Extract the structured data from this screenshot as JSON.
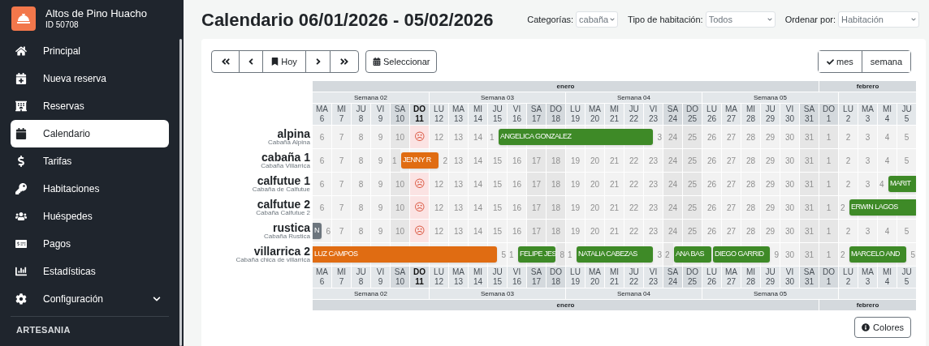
{
  "sidebar": {
    "brand": {
      "name": "Altos de Pino Huacho",
      "id": "ID 50708"
    },
    "items": [
      {
        "label": "Principal",
        "selected": false
      },
      {
        "label": "Nueva reserva",
        "selected": false
      },
      {
        "label": "Reservas",
        "selected": false
      },
      {
        "label": "Calendario",
        "selected": true
      },
      {
        "label": "Tarifas",
        "selected": false
      },
      {
        "label": "Habitaciones",
        "selected": false
      },
      {
        "label": "Huéspedes",
        "selected": false
      },
      {
        "label": "Pagos",
        "selected": false
      },
      {
        "label": "Estadísticas",
        "selected": false
      },
      {
        "label": "Configuración",
        "selected": false,
        "expanded": false
      }
    ],
    "section": "ARTESANIA"
  },
  "header": {
    "title": "Calendario 06/01/2026 - 05/02/2026",
    "filters": [
      {
        "label": "Categorías:",
        "value": "cabaña"
      },
      {
        "label": "Tipo de habitación:",
        "value": "Todos"
      },
      {
        "label": "Ordenar por:",
        "value": "Habitación"
      }
    ]
  },
  "toolbar": {
    "today_button": "Hoy",
    "select_button": "Seleccionar",
    "views": [
      {
        "label": "mes",
        "selected": true
      },
      {
        "label": "semana",
        "selected": false
      }
    ]
  },
  "calendar": {
    "top": {
      "months": [
        {
          "label": "enero",
          "weeks": [
            {
              "label": "Semana 02",
              "continued": false,
              "days": [
                {
                  "dow": "MA",
                  "day": "6",
                  "weekend": false,
                  "today": false
                },
                {
                  "dow": "MI",
                  "day": "7",
                  "weekend": false,
                  "today": false
                },
                {
                  "dow": "JU",
                  "day": "8",
                  "weekend": false,
                  "today": false
                },
                {
                  "dow": "VI",
                  "day": "9",
                  "weekend": false,
                  "today": false
                },
                {
                  "dow": "SA",
                  "day": "10",
                  "weekend": true,
                  "today": false
                },
                {
                  "dow": "DO",
                  "day": "11",
                  "weekend": true,
                  "today": true
                }
              ]
            },
            {
              "label": "Semana 03",
              "continued": false,
              "days": [
                {
                  "dow": "LU",
                  "day": "12",
                  "weekend": false,
                  "today": false
                },
                {
                  "dow": "MA",
                  "day": "13",
                  "weekend": false,
                  "today": false
                },
                {
                  "dow": "MI",
                  "day": "14",
                  "weekend": false,
                  "today": false
                },
                {
                  "dow": "JU",
                  "day": "15",
                  "weekend": false,
                  "today": false
                },
                {
                  "dow": "VI",
                  "day": "16",
                  "weekend": false,
                  "today": false
                },
                {
                  "dow": "SA",
                  "day": "17",
                  "weekend": true,
                  "today": false
                },
                {
                  "dow": "DO",
                  "day": "18",
                  "weekend": true,
                  "today": false
                }
              ]
            },
            {
              "label": "Semana 04",
              "continued": false,
              "days": [
                {
                  "dow": "LU",
                  "day": "19",
                  "weekend": false,
                  "today": false
                },
                {
                  "dow": "MA",
                  "day": "20",
                  "weekend": false,
                  "today": false
                },
                {
                  "dow": "MI",
                  "day": "21",
                  "weekend": false,
                  "today": false
                },
                {
                  "dow": "JU",
                  "day": "22",
                  "weekend": false,
                  "today": false
                },
                {
                  "dow": "VI",
                  "day": "23",
                  "weekend": false,
                  "today": false
                },
                {
                  "dow": "SA",
                  "day": "24",
                  "weekend": true,
                  "today": false
                },
                {
                  "dow": "DO",
                  "day": "25",
                  "weekend": true,
                  "today": false
                }
              ]
            },
            {
              "label": "Semana 05",
              "continued": false,
              "days": [
                {
                  "dow": "LU",
                  "day": "26",
                  "weekend": false,
                  "today": false
                },
                {
                  "dow": "MA",
                  "day": "27",
                  "weekend": false,
                  "today": false
                },
                {
                  "dow": "MI",
                  "day": "28",
                  "weekend": false,
                  "today": false
                },
                {
                  "dow": "JU",
                  "day": "29",
                  "weekend": false,
                  "today": false
                },
                {
                  "dow": "VI",
                  "day": "30",
                  "weekend": false,
                  "today": false
                },
                {
                  "dow": "SA",
                  "day": "31",
                  "weekend": true,
                  "today": false
                }
              ]
            }
          ]
        },
        {
          "label": "febrero",
          "weeks": [
            {
              "continued": true,
              "days": [
                {
                  "dow": "DO",
                  "day": "1",
                  "weekend": true,
                  "today": false
                }
              ]
            },
            {
              "continued": false,
              "days": [
                {
                  "dow": "LU",
                  "day": "2",
                  "weekend": false,
                  "today": false
                },
                {
                  "dow": "MA",
                  "day": "3",
                  "weekend": false,
                  "today": false
                },
                {
                  "dow": "MI",
                  "day": "4",
                  "weekend": false,
                  "today": false
                },
                {
                  "dow": "JU",
                  "day": "5",
                  "weekend": false,
                  "today": false
                }
              ]
            }
          ]
        }
      ]
    },
    "rooms": [
      {
        "name": "alpina",
        "description": "Cabaña Alpina",
        "cells": [
          {
            "kind": "free",
            "text": "6"
          },
          {
            "kind": "free",
            "text": "7"
          },
          {
            "kind": "free",
            "text": "8"
          },
          {
            "kind": "free",
            "text": "9"
          },
          {
            "kind": "free",
            "text": "10"
          },
          {
            "kind": "free",
            "text": "☹"
          },
          {
            "kind": "free",
            "text": "12"
          },
          {
            "kind": "free",
            "text": "13"
          },
          {
            "kind": "free",
            "text": "14"
          },
          {
            "kind": "in",
            "text": "1"
          },
          {
            "kind": "booked"
          },
          {
            "kind": "booked"
          },
          {
            "kind": "booked"
          },
          {
            "kind": "booked"
          },
          {
            "kind": "booked"
          },
          {
            "kind": "booked"
          },
          {
            "kind": "booked"
          },
          {
            "kind": "out",
            "text": "3"
          },
          {
            "kind": "free",
            "text": "24"
          },
          {
            "kind": "free",
            "text": "25"
          },
          {
            "kind": "free",
            "text": "26"
          },
          {
            "kind": "free",
            "text": "27"
          },
          {
            "kind": "free",
            "text": "28"
          },
          {
            "kind": "free",
            "text": "29"
          },
          {
            "kind": "free",
            "text": "30"
          },
          {
            "kind": "free",
            "text": "31"
          },
          {
            "kind": "free",
            "text": "1"
          },
          {
            "kind": "free",
            "text": "2"
          },
          {
            "kind": "free",
            "text": "3"
          },
          {
            "kind": "free",
            "text": "4"
          },
          {
            "kind": "free",
            "text": "5"
          }
        ],
        "bookings": [
          {
            "guest": "ANGELICA GONZALEZ",
            "color": "#3e8a27"
          }
        ]
      },
      {
        "name": "cabaña 1",
        "description": "Cabaña Villarrica",
        "cells": [
          {
            "kind": "free",
            "text": "6"
          },
          {
            "kind": "free",
            "text": "7"
          },
          {
            "kind": "free",
            "text": "8"
          },
          {
            "kind": "free",
            "text": "9"
          },
          {
            "kind": "in",
            "text": "1"
          },
          {
            "kind": "booked"
          },
          {
            "kind": "out",
            "text": "2"
          },
          {
            "kind": "free",
            "text": "13"
          },
          {
            "kind": "free",
            "text": "14"
          },
          {
            "kind": "free",
            "text": "15"
          },
          {
            "kind": "free",
            "text": "16"
          },
          {
            "kind": "free",
            "text": "17"
          },
          {
            "kind": "free",
            "text": "18"
          },
          {
            "kind": "free",
            "text": "19"
          },
          {
            "kind": "free",
            "text": "20"
          },
          {
            "kind": "free",
            "text": "21"
          },
          {
            "kind": "free",
            "text": "22"
          },
          {
            "kind": "free",
            "text": "23"
          },
          {
            "kind": "free",
            "text": "24"
          },
          {
            "kind": "free",
            "text": "25"
          },
          {
            "kind": "free",
            "text": "26"
          },
          {
            "kind": "free",
            "text": "27"
          },
          {
            "kind": "free",
            "text": "28"
          },
          {
            "kind": "free",
            "text": "29"
          },
          {
            "kind": "free",
            "text": "30"
          },
          {
            "kind": "free",
            "text": "31"
          },
          {
            "kind": "free",
            "text": "1"
          },
          {
            "kind": "free",
            "text": "2"
          },
          {
            "kind": "free",
            "text": "3"
          },
          {
            "kind": "free",
            "text": "4"
          },
          {
            "kind": "free",
            "text": "5"
          }
        ],
        "bookings": [
          {
            "guest": "JENNY R",
            "color": "#e06c12"
          }
        ]
      },
      {
        "name": "calfutue 1",
        "description": "Cabaña de Calfutue",
        "cells": [
          {
            "kind": "free",
            "text": "6"
          },
          {
            "kind": "free",
            "text": "7"
          },
          {
            "kind": "free",
            "text": "8"
          },
          {
            "kind": "free",
            "text": "9"
          },
          {
            "kind": "free",
            "text": "10"
          },
          {
            "kind": "free",
            "text": "☹"
          },
          {
            "kind": "free",
            "text": "12"
          },
          {
            "kind": "free",
            "text": "13"
          },
          {
            "kind": "free",
            "text": "14"
          },
          {
            "kind": "free",
            "text": "15"
          },
          {
            "kind": "free",
            "text": "16"
          },
          {
            "kind": "free",
            "text": "17"
          },
          {
            "kind": "free",
            "text": "18"
          },
          {
            "kind": "free",
            "text": "19"
          },
          {
            "kind": "free",
            "text": "20"
          },
          {
            "kind": "free",
            "text": "21"
          },
          {
            "kind": "free",
            "text": "22"
          },
          {
            "kind": "free",
            "text": "23"
          },
          {
            "kind": "free",
            "text": "24"
          },
          {
            "kind": "free",
            "text": "25"
          },
          {
            "kind": "free",
            "text": "26"
          },
          {
            "kind": "free",
            "text": "27"
          },
          {
            "kind": "free",
            "text": "28"
          },
          {
            "kind": "free",
            "text": "29"
          },
          {
            "kind": "free",
            "text": "30"
          },
          {
            "kind": "free",
            "text": "31"
          },
          {
            "kind": "free",
            "text": "1"
          },
          {
            "kind": "free",
            "text": "2"
          },
          {
            "kind": "free",
            "text": "3"
          },
          {
            "kind": "in",
            "text": "4"
          },
          {
            "kind": "booked"
          }
        ],
        "bookings": [
          {
            "guest": "MARIT",
            "color": "#3e8a27"
          }
        ]
      },
      {
        "name": "calfutue 2",
        "description": "Cabaña Calfutue 2",
        "cells": [
          {
            "kind": "free",
            "text": "6"
          },
          {
            "kind": "free",
            "text": "7"
          },
          {
            "kind": "free",
            "text": "8"
          },
          {
            "kind": "free",
            "text": "9"
          },
          {
            "kind": "free",
            "text": "10"
          },
          {
            "kind": "free",
            "text": "☹"
          },
          {
            "kind": "free",
            "text": "12"
          },
          {
            "kind": "free",
            "text": "13"
          },
          {
            "kind": "free",
            "text": "14"
          },
          {
            "kind": "free",
            "text": "15"
          },
          {
            "kind": "free",
            "text": "16"
          },
          {
            "kind": "free",
            "text": "17"
          },
          {
            "kind": "free",
            "text": "18"
          },
          {
            "kind": "free",
            "text": "19"
          },
          {
            "kind": "free",
            "text": "20"
          },
          {
            "kind": "free",
            "text": "21"
          },
          {
            "kind": "free",
            "text": "22"
          },
          {
            "kind": "free",
            "text": "23"
          },
          {
            "kind": "free",
            "text": "24"
          },
          {
            "kind": "free",
            "text": "25"
          },
          {
            "kind": "free",
            "text": "26"
          },
          {
            "kind": "free",
            "text": "27"
          },
          {
            "kind": "free",
            "text": "28"
          },
          {
            "kind": "free",
            "text": "29"
          },
          {
            "kind": "free",
            "text": "30"
          },
          {
            "kind": "free",
            "text": "31"
          },
          {
            "kind": "free",
            "text": "1"
          },
          {
            "kind": "in",
            "text": "2"
          },
          {
            "kind": "booked"
          },
          {
            "kind": "booked"
          },
          {
            "kind": "booked"
          }
        ],
        "bookings": [
          {
            "guest": "ERWIN LAGOS",
            "color": "#3e8a27"
          }
        ]
      },
      {
        "name": "rustica",
        "description": "Cabaña Rustica",
        "cells": [
          {
            "kind": "out",
            "text": "6"
          },
          {
            "kind": "free",
            "text": "7"
          },
          {
            "kind": "free",
            "text": "8"
          },
          {
            "kind": "free",
            "text": "9"
          },
          {
            "kind": "free",
            "text": "10"
          },
          {
            "kind": "free",
            "text": "☹"
          },
          {
            "kind": "free",
            "text": "12"
          },
          {
            "kind": "free",
            "text": "13"
          },
          {
            "kind": "free",
            "text": "14"
          },
          {
            "kind": "free",
            "text": "15"
          },
          {
            "kind": "free",
            "text": "16"
          },
          {
            "kind": "free",
            "text": "17"
          },
          {
            "kind": "free",
            "text": "18"
          },
          {
            "kind": "free",
            "text": "19"
          },
          {
            "kind": "free",
            "text": "20"
          },
          {
            "kind": "free",
            "text": "21"
          },
          {
            "kind": "free",
            "text": "22"
          },
          {
            "kind": "free",
            "text": "23"
          },
          {
            "kind": "free",
            "text": "24"
          },
          {
            "kind": "free",
            "text": "25"
          },
          {
            "kind": "free",
            "text": "26"
          },
          {
            "kind": "free",
            "text": "27"
          },
          {
            "kind": "free",
            "text": "28"
          },
          {
            "kind": "free",
            "text": "29"
          },
          {
            "kind": "free",
            "text": "30"
          },
          {
            "kind": "free",
            "text": "31"
          },
          {
            "kind": "free",
            "text": "1"
          },
          {
            "kind": "free",
            "text": "2"
          },
          {
            "kind": "free",
            "text": "3"
          },
          {
            "kind": "free",
            "text": "4"
          },
          {
            "kind": "free",
            "text": "5"
          }
        ],
        "bookings": [
          {
            "guest": "N",
            "color": "#6c757d"
          }
        ]
      },
      {
        "name": "villarrica 2",
        "description": "Cabaña chica de villarrica",
        "cells": [
          {
            "kind": "booked"
          },
          {
            "kind": "booked"
          },
          {
            "kind": "booked"
          },
          {
            "kind": "booked"
          },
          {
            "kind": "booked"
          },
          {
            "kind": "booked"
          },
          {
            "kind": "booked"
          },
          {
            "kind": "booked"
          },
          {
            "kind": "booked"
          },
          {
            "kind": "out",
            "text": "5"
          },
          {
            "kind": "in",
            "text": "1"
          },
          {
            "kind": "booked"
          },
          {
            "kind": "out",
            "text": "8"
          },
          {
            "kind": "in",
            "text": "1"
          },
          {
            "kind": "booked"
          },
          {
            "kind": "booked"
          },
          {
            "kind": "booked"
          },
          {
            "kind": "out",
            "text": "3"
          },
          {
            "kind": "in",
            "text": "2"
          },
          {
            "kind": "booked"
          },
          {
            "kind": "turnover"
          },
          {
            "kind": "booked"
          },
          {
            "kind": "booked"
          },
          {
            "kind": "out",
            "text": "9"
          },
          {
            "kind": "free",
            "text": "30"
          },
          {
            "kind": "free",
            "text": "31"
          },
          {
            "kind": "free",
            "text": "1"
          },
          {
            "kind": "in",
            "text": "2"
          },
          {
            "kind": "booked"
          },
          {
            "kind": "booked"
          },
          {
            "kind": "out",
            "text": "5"
          }
        ],
        "bookings": [
          {
            "guest": "LUZ CAMPOS",
            "color": "#e06c12"
          },
          {
            "guest": "FELIPE JES",
            "color": "#3e8a27"
          },
          {
            "guest": "NATALIA CABEZAS",
            "color": "#3e8a27"
          },
          {
            "guest": "ANA BAS",
            "color": "#3e8a27"
          },
          {
            "guest": "DIEGO GARRID",
            "color": "#3e8a27"
          },
          {
            "guest": "MARCELO AND",
            "color": "#3e8a27"
          }
        ]
      }
    ],
    "bottom": {
      "months": [
        {
          "label": "enero",
          "weeks": [
            {
              "label": "Semana 02",
              "continued": false,
              "days": [
                {
                  "dow": "MA",
                  "day": "6",
                  "weekend": false,
                  "today": false
                },
                {
                  "dow": "MI",
                  "day": "7",
                  "weekend": false,
                  "today": false
                },
                {
                  "dow": "JU",
                  "day": "8",
                  "weekend": false,
                  "today": false
                },
                {
                  "dow": "VI",
                  "day": "9",
                  "weekend": false,
                  "today": false
                },
                {
                  "dow": "SA",
                  "day": "10",
                  "weekend": true,
                  "today": false
                },
                {
                  "dow": "DO",
                  "day": "11",
                  "weekend": true,
                  "today": true
                }
              ]
            },
            {
              "label": "Semana 03",
              "continued": false,
              "days": [
                {
                  "dow": "LU",
                  "day": "12",
                  "weekend": false,
                  "today": false
                },
                {
                  "dow": "MA",
                  "day": "13",
                  "weekend": false,
                  "today": false
                },
                {
                  "dow": "MI",
                  "day": "14",
                  "weekend": false,
                  "today": false
                },
                {
                  "dow": "JU",
                  "day": "15",
                  "weekend": false,
                  "today": false
                },
                {
                  "dow": "VI",
                  "day": "16",
                  "weekend": false,
                  "today": false
                },
                {
                  "dow": "SA",
                  "day": "17",
                  "weekend": true,
                  "today": false
                },
                {
                  "dow": "DO",
                  "day": "18",
                  "weekend": true,
                  "today": false
                }
              ]
            },
            {
              "label": "Semana 04",
              "continued": false,
              "days": [
                {
                  "dow": "LU",
                  "day": "19",
                  "weekend": false,
                  "today": false
                },
                {
                  "dow": "MA",
                  "day": "20",
                  "weekend": false,
                  "today": false
                },
                {
                  "dow": "MI",
                  "day": "21",
                  "weekend": false,
                  "today": false
                },
                {
                  "dow": "JU",
                  "day": "22",
                  "weekend": false,
                  "today": false
                },
                {
                  "dow": "VI",
                  "day": "23",
                  "weekend": false,
                  "today": false
                },
                {
                  "dow": "SA",
                  "day": "24",
                  "weekend": true,
                  "today": false
                },
                {
                  "dow": "DO",
                  "day": "25",
                  "weekend": true,
                  "today": false
                }
              ]
            },
            {
              "label": "Semana 05",
              "continued": false,
              "days": [
                {
                  "dow": "LU",
                  "day": "26",
                  "weekend": false,
                  "today": false
                },
                {
                  "dow": "MA",
                  "day": "27",
                  "weekend": false,
                  "today": false
                },
                {
                  "dow": "MI",
                  "day": "28",
                  "weekend": false,
                  "today": false
                },
                {
                  "dow": "JU",
                  "day": "29",
                  "weekend": false,
                  "today": false
                },
                {
                  "dow": "VI",
                  "day": "30",
                  "weekend": false,
                  "today": false
                },
                {
                  "dow": "SA",
                  "day": "31",
                  "weekend": true,
                  "today": false
                }
              ]
            }
          ]
        },
        {
          "label": "febrero",
          "weeks": [
            {
              "continued": true,
              "days": [
                {
                  "dow": "DO",
                  "day": "1",
                  "weekend": true,
                  "today": false
                }
              ]
            },
            {
              "continued": false,
              "days": [
                {
                  "dow": "LU",
                  "day": "2",
                  "weekend": false,
                  "today": false
                },
                {
                  "dow": "MA",
                  "day": "3",
                  "weekend": false,
                  "today": false
                },
                {
                  "dow": "MI",
                  "day": "4",
                  "weekend": false,
                  "today": false
                },
                {
                  "dow": "JU",
                  "day": "5",
                  "weekend": false,
                  "today": false
                }
              ]
            }
          ]
        }
      ]
    }
  },
  "colors_button": "Colores"
}
